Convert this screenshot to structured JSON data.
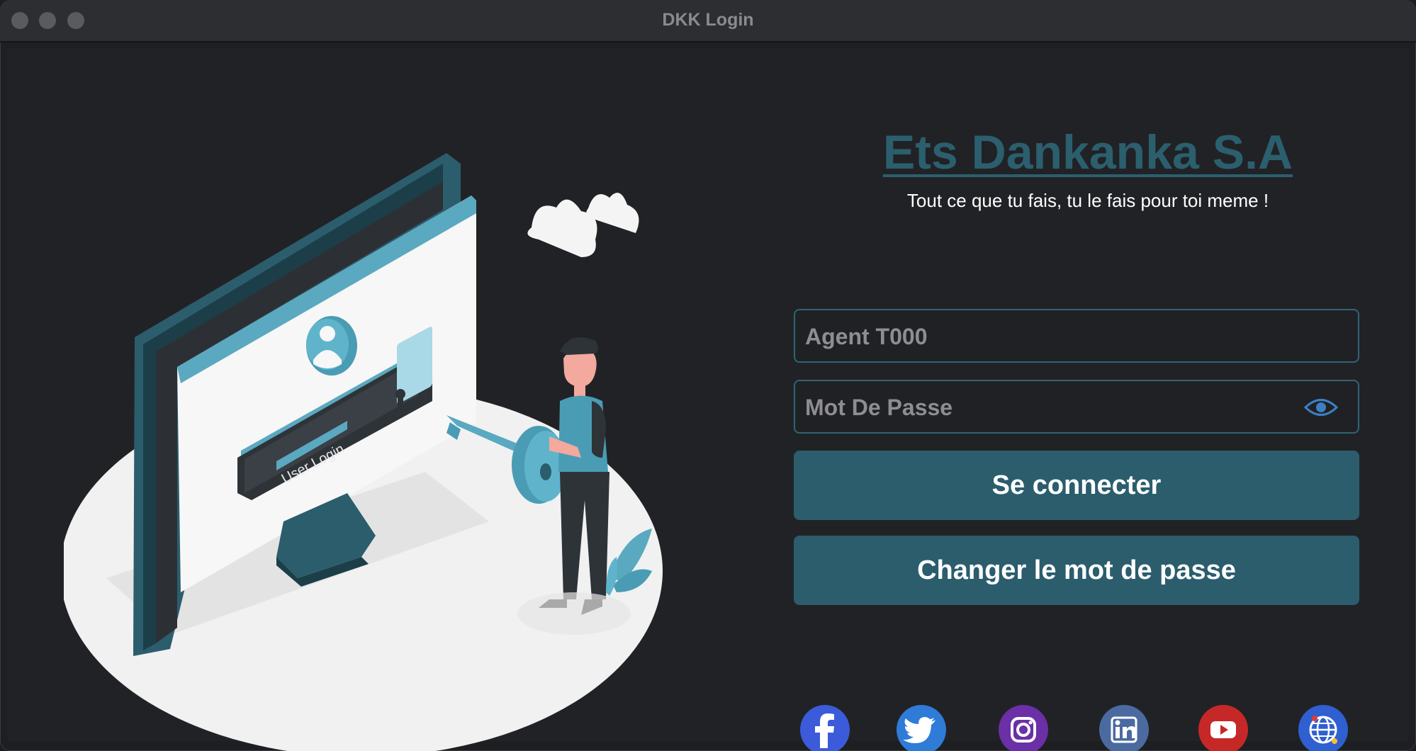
{
  "window": {
    "title": "DKK Login"
  },
  "brand": {
    "name": "Ets Dankanka S.A",
    "tagline": "Tout ce que tu fais, tu le fais pour toi meme !"
  },
  "illustration": {
    "screen_text": "User Login"
  },
  "form": {
    "username_placeholder": "Agent T000",
    "password_placeholder": "Mot De Passe",
    "login_label": "Se connecter",
    "change_password_label": "Changer le mot de passe"
  },
  "social": [
    "facebook-icon",
    "twitter-icon",
    "instagram-icon",
    "linkedin-icon",
    "youtube-icon",
    "website-globe-icon"
  ],
  "colors": {
    "accent": "#2b5d6d",
    "brand_text": "#2b5f6e",
    "field_border": "#2e6576",
    "background": "#212226"
  }
}
